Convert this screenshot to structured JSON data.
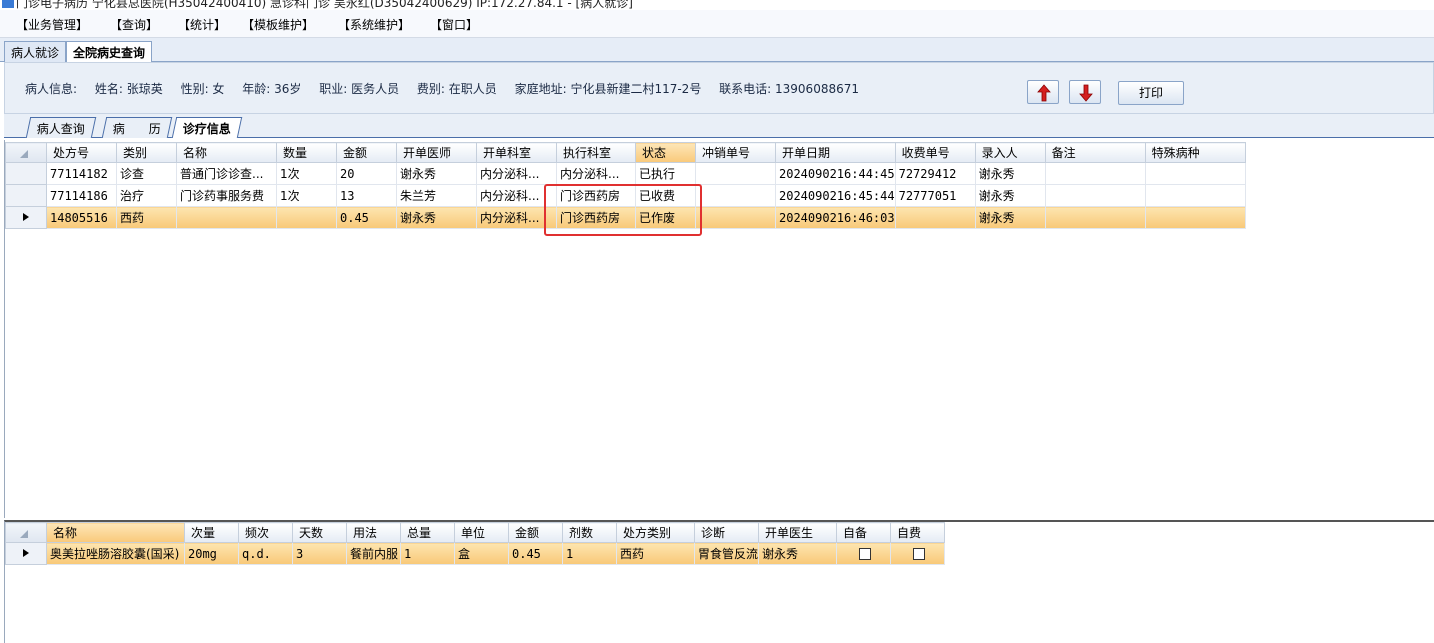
{
  "window": {
    "title": "门诊电子病历 宁化县总医院(H35042400410) 急诊科门诊 吴永红(D35042400629) IP:172.27.84.1 - [病人就诊]"
  },
  "menu": [
    "【业务管理】",
    "【查询】",
    "【统计】",
    "【模板维护】",
    "【系统维护】",
    "【窗口】"
  ],
  "outer_tabs": [
    "病人就诊",
    "全院病史查询"
  ],
  "patient": {
    "label": "病人信息:",
    "name": "姓名: 张琼英",
    "sex": "性别: 女",
    "age": "年龄: 36岁",
    "job": "职业: 医务人员",
    "fee_type": "费别: 在职人员",
    "address": "家庭地址: 宁化县新建二村117-2号",
    "phone": "联系电话: 13906088671"
  },
  "buttons": {
    "print": "打印"
  },
  "inner_tabs": [
    "病人查询",
    "病　　历",
    "诊疗信息"
  ],
  "grid1": {
    "columns": [
      "处方号",
      "类别",
      "名称",
      "数量",
      "金额",
      "开单医师",
      "开单科室",
      "执行科室",
      "状态",
      "冲销单号",
      "开单日期",
      "收费单号",
      "录入人",
      "备注",
      "特殊病种"
    ],
    "rows": [
      [
        "77114182",
        "诊查",
        "普通门诊诊查...",
        "1次",
        "20",
        "谢永秀",
        "内分泌科...",
        "内分泌科...",
        "已执行",
        "",
        "2024090216:44:45",
        "72729412",
        "谢永秀",
        "",
        ""
      ],
      [
        "77114186",
        "治疗",
        "门诊药事服务费",
        "1次",
        "13",
        "朱兰芳",
        "内分泌科...",
        "门诊西药房",
        "已收费",
        "",
        "2024090216:45:44",
        "72777051",
        "谢永秀",
        "",
        ""
      ],
      [
        "14805516",
        "西药",
        "",
        "",
        "0.45",
        "谢永秀",
        "内分泌科...",
        "门诊西药房",
        "已作废",
        "",
        "2024090216:46:03",
        "",
        "谢永秀",
        "",
        ""
      ]
    ]
  },
  "grid2": {
    "columns": [
      "名称",
      "次量",
      "频次",
      "天数",
      "用法",
      "总量",
      "单位",
      "金额",
      "剂数",
      "处方类别",
      "诊断",
      "开单医生",
      "自备",
      "自费"
    ],
    "rows": [
      [
        "奥美拉唑肠溶胶囊(国采)",
        "20mg",
        "q.d.",
        "3",
        "餐前内服",
        "1",
        "盒",
        "0.45",
        "1",
        "西药",
        "胃食管反流",
        "谢永秀",
        "",
        ""
      ]
    ]
  }
}
